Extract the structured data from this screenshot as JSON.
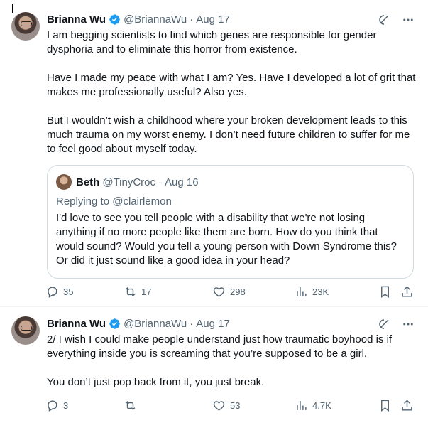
{
  "tweets": [
    {
      "author": {
        "name": "Brianna Wu",
        "handle": "@BriannaWu",
        "date": "Aug 17"
      },
      "paragraphs": [
        "I am begging scientists to find which genes are responsible for gender dysphoria and to eliminate this horror from existence.",
        "Have I made my peace with what I am? Yes. Have I developed a lot of grit that makes me professionally useful? Also yes.",
        "But I wouldn’t wish a childhood where your broken development leads to this much trauma on my worst enemy. I don’t need future children to suffer for me to feel good about myself today."
      ],
      "quote": {
        "name": "Beth",
        "handle": "@TinyCroc",
        "date": "Aug 16",
        "replying_label": "Replying to",
        "replying_to": "@clairlemon",
        "text": "I'd love to see you tell people with a disability that we're not losing anything if no more people like them are born. How do you think that would sound? Would you tell a young person with Down Syndrome this? Or did it just sound like a good idea in your head?"
      },
      "stats": {
        "replies": "35",
        "reposts": "17",
        "likes": "298",
        "views": "23K"
      }
    },
    {
      "author": {
        "name": "Brianna Wu",
        "handle": "@BriannaWu",
        "date": "Aug 17"
      },
      "paragraphs": [
        "2/ I wish I could make people understand just how traumatic boyhood is if everything inside you is screaming that you’re supposed to be a girl.",
        "You don’t just pop back from it, you just break."
      ],
      "stats": {
        "replies": "3",
        "reposts": "",
        "likes": "53",
        "views": "4.7K"
      }
    }
  ],
  "separator": "·",
  "colors": {
    "text": "#0f1419",
    "secondary": "#536471",
    "verified": "#1d9bf0",
    "border": "#cfd9de"
  },
  "icons": [
    "verified-badge-icon",
    "grok-icon",
    "more-icon",
    "reply-icon",
    "repost-icon",
    "like-icon",
    "views-icon",
    "bookmark-icon",
    "share-icon"
  ]
}
